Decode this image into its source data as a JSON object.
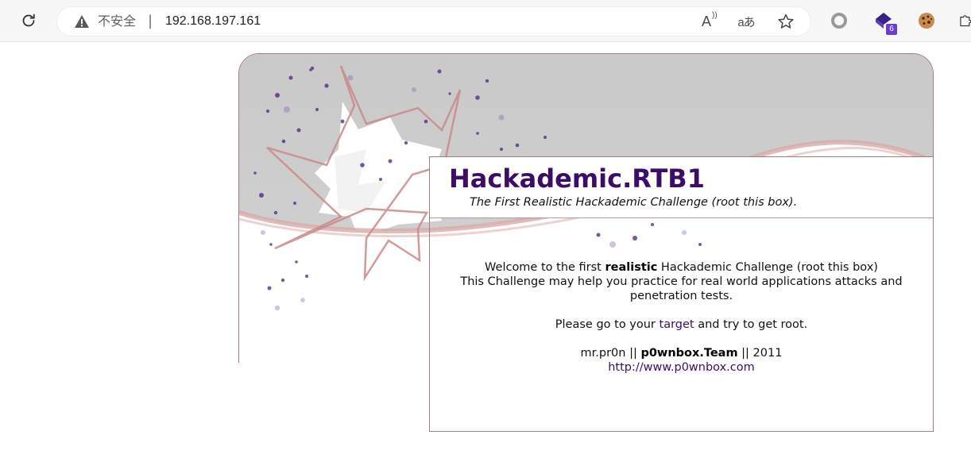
{
  "browser": {
    "security_label": "不安全",
    "separator": "|",
    "url": "192.168.197.161",
    "icons": {
      "reload": "reload-icon",
      "warning": "warning-triangle-icon",
      "read_aloud": "read-aloud-icon",
      "translate": "translate-icon",
      "favorite": "star-icon",
      "extension_1": "circle-extension-icon",
      "extension_2": "purple-diamond-extension-icon",
      "extension_3": "cookie-extension-icon",
      "extensions": "puzzle-icon"
    },
    "read_aloud_glyph": "A",
    "translate_glyph": "aあ",
    "extension_badge": "6",
    "colors": {
      "accent": "#6a3fd0"
    }
  },
  "page": {
    "title": "Hackademic.RTB1",
    "subtitle": "The First Realistic Hackademic Challenge (root this box).",
    "welcome_prefix": "Welcome to the first ",
    "welcome_bold": "realistic",
    "welcome_suffix": " Hackademic Challenge (root this box)",
    "challenge_line": "This Challenge may help you practice for real world applications attacks and penetration tests.",
    "go_prefix": "Please go to your ",
    "target_link": "target",
    "go_suffix": " and try to get root.",
    "author_prefix": "mr.pr0n || ",
    "team_bold": "p0wnbox.Team",
    "year_suffix": " || 2011",
    "website_link": "http://www.p0wnbox.com",
    "colors": {
      "title": "#3c0d66",
      "link": "#3c0d66",
      "frame": "#a77c7c",
      "header_grey": "#cbcbcb",
      "swoosh": "#d9a9a9"
    }
  }
}
